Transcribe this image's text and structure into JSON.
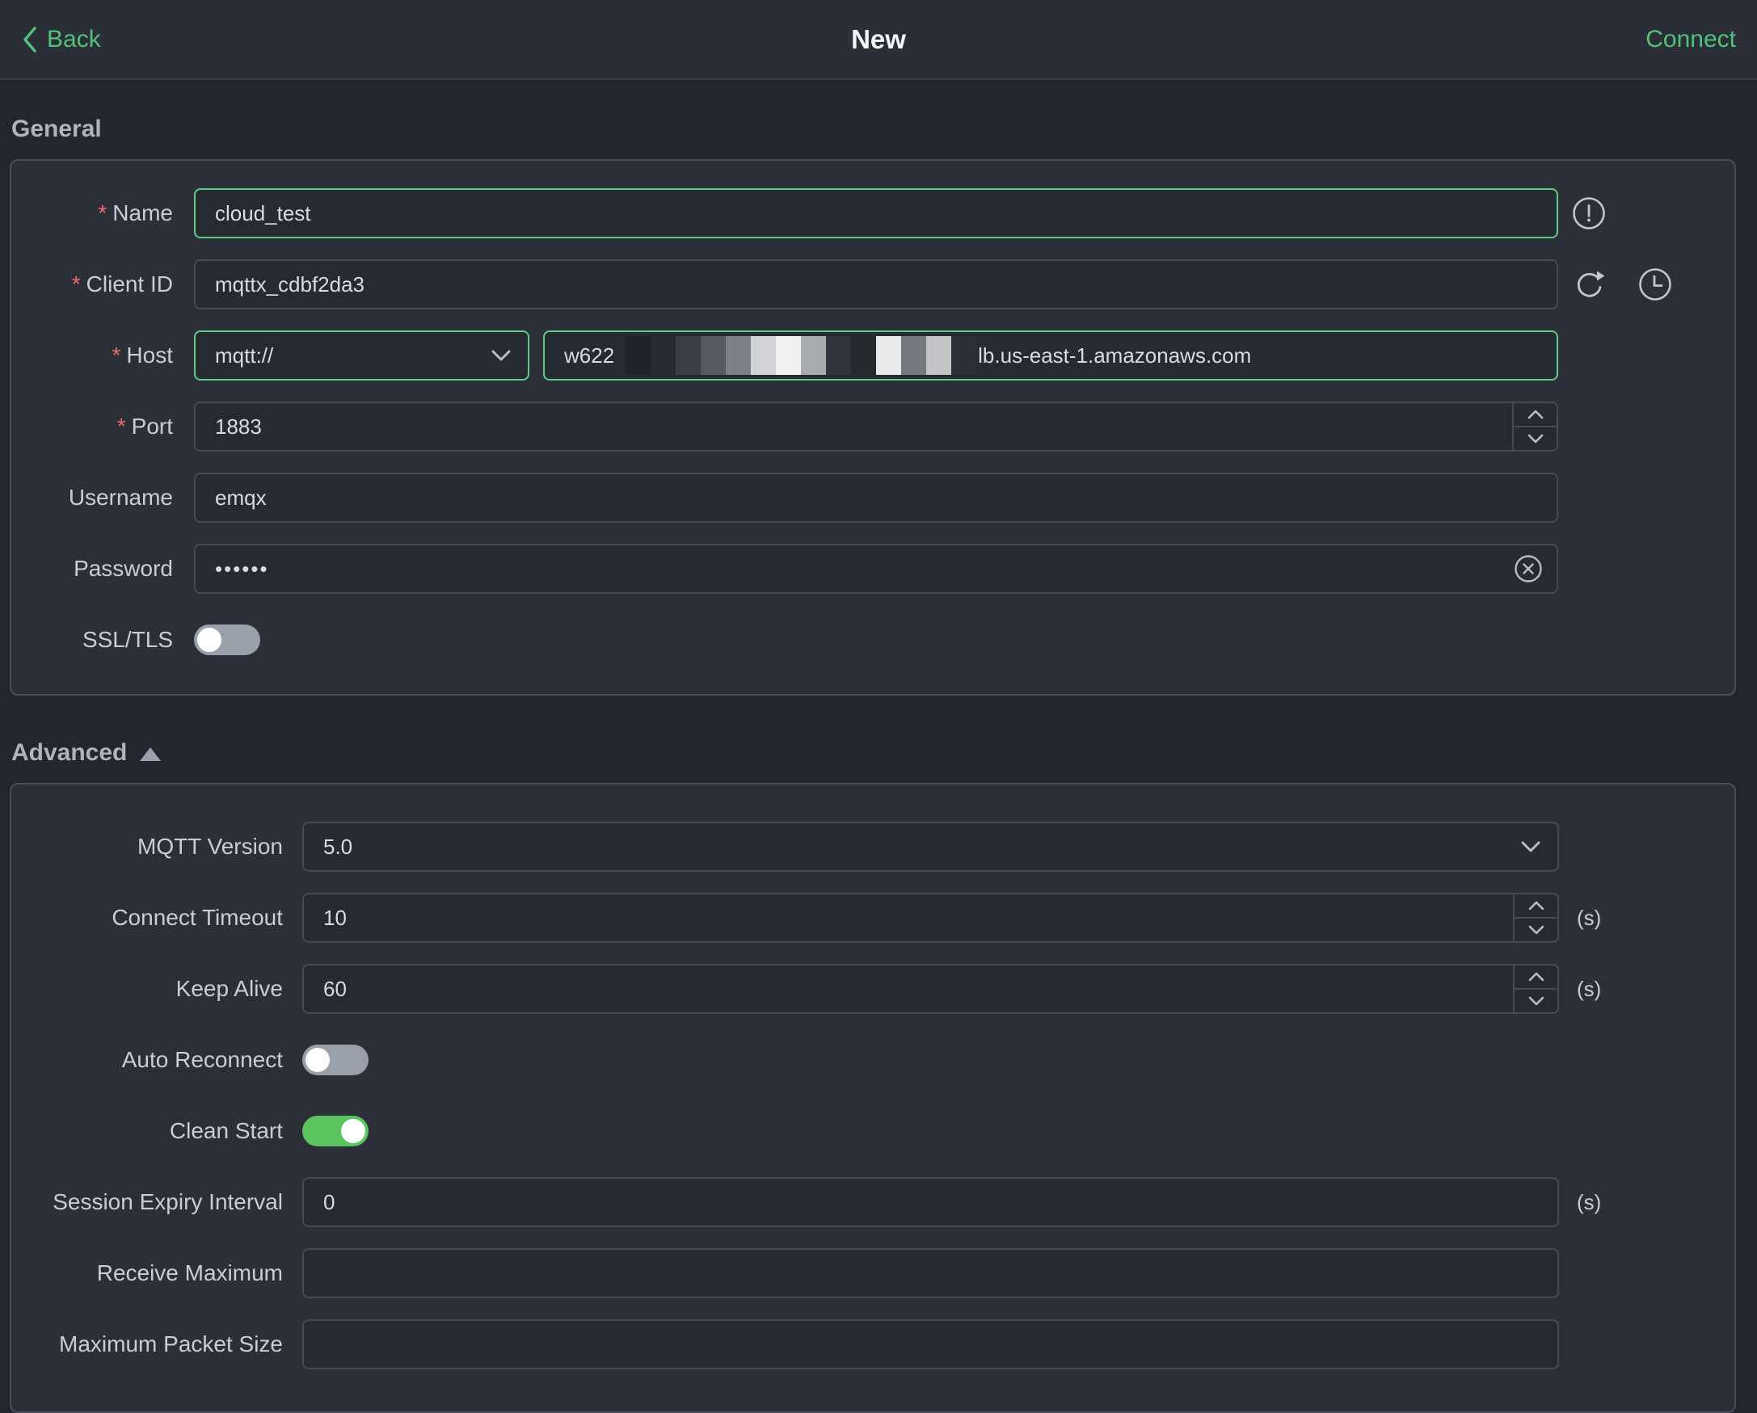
{
  "topbar": {
    "back_label": "Back",
    "title": "New",
    "connect_label": "Connect"
  },
  "misc": {
    "required_mark": "*"
  },
  "general": {
    "title": "General",
    "name": {
      "label": "Name",
      "value": "cloud_test"
    },
    "client_id": {
      "label": "Client ID",
      "value": "mqttx_cdbf2da3"
    },
    "host": {
      "label": "Host",
      "protocol": "mqtt://",
      "value_prefix": "w622",
      "value_suffix": "lb.us-east-1.amazonaws.com"
    },
    "port": {
      "label": "Port",
      "value": "1883"
    },
    "username": {
      "label": "Username",
      "value": "emqx"
    },
    "password": {
      "label": "Password",
      "value": "••••••"
    },
    "ssl": {
      "label": "SSL/TLS",
      "state": "off"
    }
  },
  "advanced": {
    "title": "Advanced",
    "mqtt_version": {
      "label": "MQTT Version",
      "value": "5.0"
    },
    "connect_timeout": {
      "label": "Connect Timeout",
      "value": "10",
      "unit": "(s)"
    },
    "keep_alive": {
      "label": "Keep Alive",
      "value": "60",
      "unit": "(s)"
    },
    "auto_reconnect": {
      "label": "Auto Reconnect",
      "state": "off"
    },
    "clean_start": {
      "label": "Clean Start",
      "state": "on"
    },
    "session_expiry": {
      "label": "Session Expiry Interval",
      "value": "0",
      "unit": "(s)"
    },
    "receive_maximum": {
      "label": "Receive Maximum",
      "value": ""
    },
    "max_packet_size": {
      "label": "Maximum Packet Size",
      "value": ""
    }
  },
  "colors": {
    "accent_green": "#53c07c",
    "focus_border_green": "#5ecc86",
    "toggle_on_green": "#5cc45e",
    "required_red": "#f16b6b",
    "page_bg": "#22262d",
    "card_bg": "#2b2f38"
  },
  "icons": [
    "back-chevron-icon",
    "info-circle-icon",
    "refresh-icon",
    "history-clock-icon",
    "chevron-down-icon",
    "stepper-up-icon",
    "stepper-down-icon",
    "clear-circle-icon",
    "collapse-triangle-icon"
  ]
}
